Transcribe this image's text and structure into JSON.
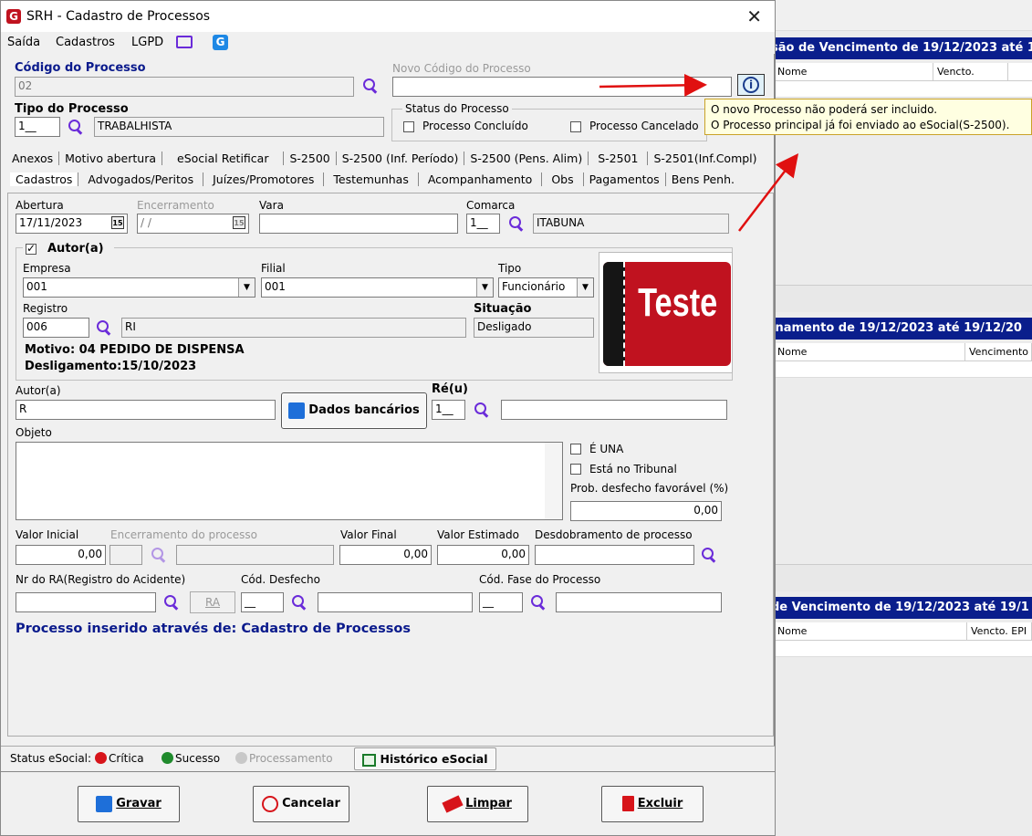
{
  "window": {
    "title": "SRH - Cadastro de Processos",
    "close": "✕"
  },
  "menu": [
    "Saída",
    "Cadastros",
    "LGPD"
  ],
  "codigo": {
    "label": "Código do Processo",
    "value": "02"
  },
  "novo_codigo": {
    "label": "Novo Código do Processo",
    "value": ""
  },
  "tipo": {
    "label": "Tipo do Processo",
    "code": "1__",
    "desc": "TRABALHISTA"
  },
  "status_processo": {
    "legend": "Status do Processo",
    "concluido": "Processo Concluído",
    "cancelado": "Processo Cancelado"
  },
  "tooltip": {
    "line1": "O novo Processo não poderá ser incluido.",
    "line2": "O Processo principal já foi enviado ao eSocial(S-2500)."
  },
  "tabs_row1": [
    "Anexos",
    "Motivo abertura",
    "eSocial Retificar",
    "S-2500",
    "S-2500 (Inf. Período)",
    "S-2500 (Pens. Alim)",
    "S-2501",
    "S-2501(Inf.Compl)"
  ],
  "tabs_row2": [
    "Cadastros",
    "Advogados/Peritos",
    "Juízes/Promotores",
    "Testemunhas",
    "Acompanhamento",
    "Obs",
    "Pagamentos",
    "Bens Penh."
  ],
  "abertura": {
    "label": "Abertura",
    "value": "17/11/2023",
    "cal": "15"
  },
  "encerramento": {
    "label": "Encerramento",
    "value": " / /",
    "cal": "15"
  },
  "vara": {
    "label": "Vara",
    "value": ""
  },
  "comarca": {
    "label": "Comarca",
    "code": "1__",
    "desc": "ITABUNA"
  },
  "autor_group": {
    "legend": "Autor(a)"
  },
  "empresa": {
    "label": "Empresa",
    "value": "001"
  },
  "filial": {
    "label": "Filial",
    "value": "001"
  },
  "tipo_func": {
    "label": "Tipo",
    "value": "Funcionário"
  },
  "registro": {
    "label": "Registro",
    "value": "006",
    "name": "RI"
  },
  "situacao": {
    "label": "Situação",
    "value": "Desligado"
  },
  "motivo": "Motivo: 04 PEDIDO DE DISPENSA",
  "desligamento": "Desligamento:15/10/2023",
  "teste_label": "Teste",
  "autor": {
    "label": "Autor(a)",
    "value": "R"
  },
  "dados_bancarios": "Dados bancários",
  "reu": {
    "label": "Ré(u)",
    "code": "1__",
    "desc": ""
  },
  "objeto": {
    "label": "Objeto",
    "value": ""
  },
  "e_una": "É UNA",
  "tribunal": "Está no Tribunal",
  "prob": {
    "label": "Prob. desfecho favorável (%)",
    "value": "0,00"
  },
  "valor_inicial": {
    "label": "Valor Inicial",
    "value": "0,00"
  },
  "enc_processo": {
    "label": "Encerramento do processo"
  },
  "valor_final": {
    "label": "Valor Final",
    "value": "0,00"
  },
  "valor_estimado": {
    "label": "Valor Estimado",
    "value": "0,00"
  },
  "desdobramento": {
    "label": "Desdobramento de processo",
    "value": ""
  },
  "nr_ra": {
    "label": "Nr do RA(Registro do Acidente)",
    "value": "",
    "btn": "RA"
  },
  "cod_desfecho": {
    "label": "Cód. Desfecho",
    "code": "__"
  },
  "cod_fase": {
    "label": "Cód. Fase do Processo",
    "code": "__"
  },
  "inserido": "Processo inserido através de: Cadastro de Processos",
  "status_esocial": {
    "label": "Status eSocial:",
    "critica": "Crítica",
    "sucesso": "Sucesso",
    "processamento": "Processamento",
    "historico": "Histórico eSocial"
  },
  "buttons": {
    "gravar": "Gravar",
    "cancelar": "Cancelar",
    "limpar": "Limpar",
    "excluir": "Excluir"
  },
  "background": {
    "title1": "são de Vencimento de 19/12/2023 até 1",
    "cols1": [
      "Nome",
      "Vencto. Exame"
    ],
    "title2": "inamento de 19/12/2023 até 19/12/20",
    "cols2": [
      "Nome",
      "Vencimento"
    ],
    "title3": "de Vencimento de 19/12/2023 até 19/1",
    "cols3": [
      "Nome",
      "Vencto. EPI"
    ]
  },
  "colors": {
    "accent": "#0a1a8c",
    "red": "#c0121f",
    "purple": "#6a2bd9"
  }
}
